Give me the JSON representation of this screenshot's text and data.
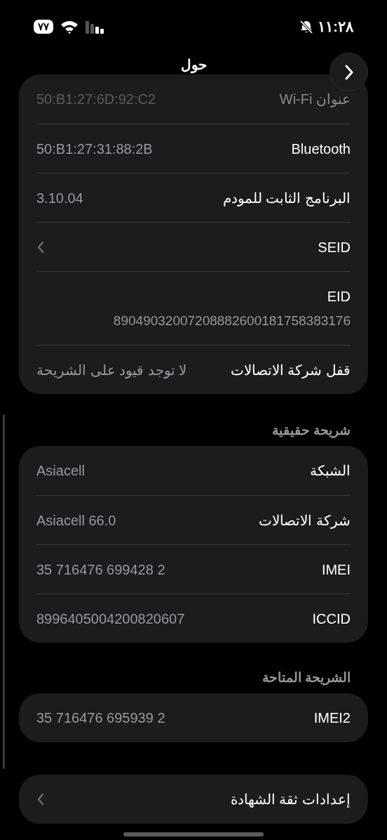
{
  "status_bar": {
    "battery": "٧٧",
    "time": "١١:٢٨"
  },
  "nav": {
    "title": "حول"
  },
  "sections": [
    {
      "rows": [
        {
          "kind": "value",
          "label": "عنوان Wi-Fi",
          "value": "50:B1:27:6D:92:C2",
          "dimmed": true
        },
        {
          "kind": "value",
          "label": "Bluetooth",
          "value": "50:B1:27:31:88:2B",
          "dimmed": false
        },
        {
          "kind": "value",
          "label": "البرنامج الثابت للمودم",
          "value": "3.10.04",
          "dimmed": false
        },
        {
          "kind": "chevron",
          "label": "SEID",
          "dimmed": false
        },
        {
          "kind": "stacked",
          "label": "EID",
          "value": "89049032007208882600181758383176",
          "dimmed": false
        },
        {
          "kind": "value",
          "label": "قفل شركة الاتصالات",
          "value": "لا توجد قيود على الشريحة",
          "dimmed": false
        }
      ]
    },
    {
      "header": "شريحة حقيقية",
      "rows": [
        {
          "kind": "value",
          "label": "الشبكة",
          "value": "Asiacell",
          "dimmed": false
        },
        {
          "kind": "value",
          "label": "شركة الاتصالات",
          "value": "Asiacell 66.0",
          "dimmed": false
        },
        {
          "kind": "value",
          "label": "IMEI",
          "value": "35 716476 699428 2",
          "dimmed": false
        },
        {
          "kind": "value",
          "label": "ICCID",
          "value": "8996405004200820607",
          "dimmed": false
        }
      ]
    },
    {
      "header": "الشريحة المتاحة",
      "rows": [
        {
          "kind": "value",
          "label": "IMEI2",
          "value": "35 716476 695939 2",
          "dimmed": false
        }
      ]
    },
    {
      "rows": [
        {
          "kind": "chevron",
          "label": "إعدادات ثقة الشهادة",
          "dimmed": false
        }
      ]
    }
  ]
}
